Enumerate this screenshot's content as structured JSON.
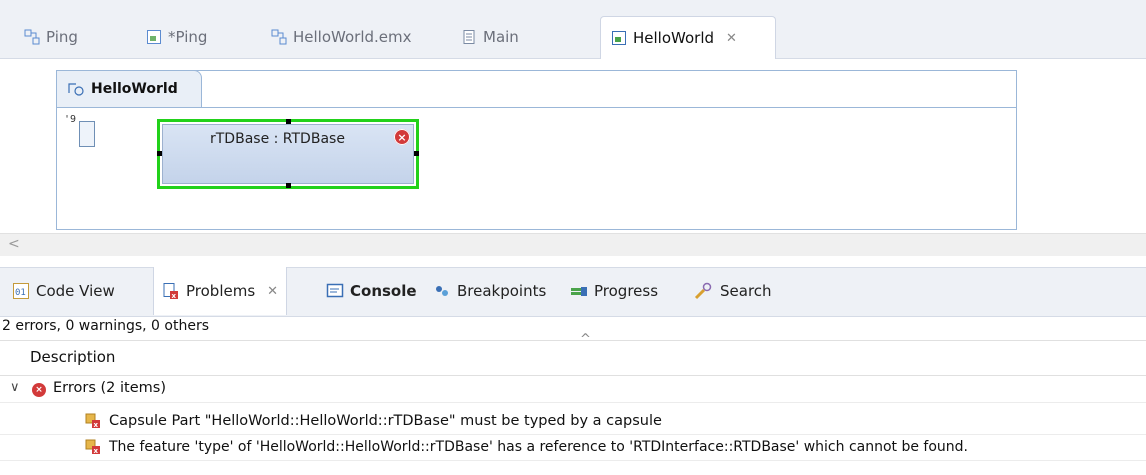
{
  "editor_tabs": [
    {
      "label": "Ping",
      "icon": "model-icon"
    },
    {
      "label": "*Ping",
      "icon": "capsule-icon"
    },
    {
      "label": "HelloWorld.emx",
      "icon": "model-icon"
    },
    {
      "label": "Main",
      "icon": "document-icon"
    },
    {
      "label": "HelloWorld",
      "icon": "capsule-icon",
      "close": "✕"
    }
  ],
  "diagram": {
    "frame_title": "HelloWorld",
    "part_label": "rTDBase : RTDBase",
    "port_label": "'9",
    "error_glyph": "×",
    "scroll_left": "<"
  },
  "view_tabs": [
    {
      "label": "Code View"
    },
    {
      "label": "Problems",
      "close": "✕"
    },
    {
      "label": "Console"
    },
    {
      "label": "Breakpoints"
    },
    {
      "label": "Progress"
    },
    {
      "label": "Search"
    }
  ],
  "problems": {
    "summary": "2 errors, 0 warnings, 0 others",
    "column_header": "Description",
    "sort_caret": "^",
    "group_label": "Errors (2 items)",
    "group_chevron": "∨",
    "items": [
      "Capsule Part \"HelloWorld::HelloWorld::rTDBase\" must be typed by a capsule",
      "The feature 'type' of 'HelloWorld::HelloWorld::rTDBase' has a reference to 'RTDInterface::RTDBase' which cannot be found."
    ]
  },
  "colors": {
    "selection": "#22d11a",
    "error": "#d23a3a",
    "frame_border": "#9bb7d8"
  }
}
